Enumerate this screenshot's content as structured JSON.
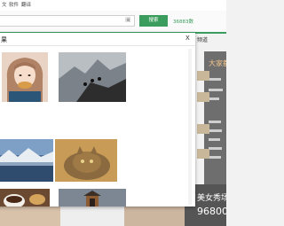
{
  "nav": {
    "item_1": "文",
    "item_2": "软件",
    "item_3": "翻译"
  },
  "search": {
    "button_label": "搜索",
    "hotline": "36883数"
  },
  "sidebar": {
    "tab_label": "频道",
    "panel_title": "大家都",
    "promo_line1": "美女秀场",
    "promo_line2": "96800"
  },
  "modal": {
    "title": "果",
    "close_label": "X",
    "images": [
      {
        "name": "girl-eating-bread"
      },
      {
        "name": "mountain-climbers"
      },
      {
        "name": "lake-mountains"
      },
      {
        "name": "tabby-cat"
      },
      {
        "name": "coffee-cookies"
      },
      {
        "name": "pagoda-gate"
      }
    ]
  },
  "colors": {
    "accent_green": "#3a9d5d",
    "panel_dark": "#6e6e6e"
  }
}
